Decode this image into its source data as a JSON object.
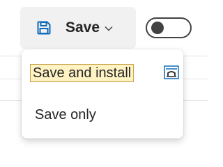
{
  "toolbar": {
    "save_label": "Save",
    "save_icon": "save-icon",
    "dropdown_icon": "chevron-down-icon",
    "toggle_state": "off"
  },
  "menu": {
    "items": [
      {
        "label": "Save and install",
        "highlighted": true,
        "trailing_icon": "install-icon"
      },
      {
        "label": "Save only",
        "highlighted": false
      }
    ]
  },
  "colors": {
    "button_bg": "#f1f1f1",
    "icon_accent": "#0f6cbd",
    "highlight_bg": "#fff3c4",
    "highlight_border": "#c8a24a",
    "text": "#242424"
  }
}
